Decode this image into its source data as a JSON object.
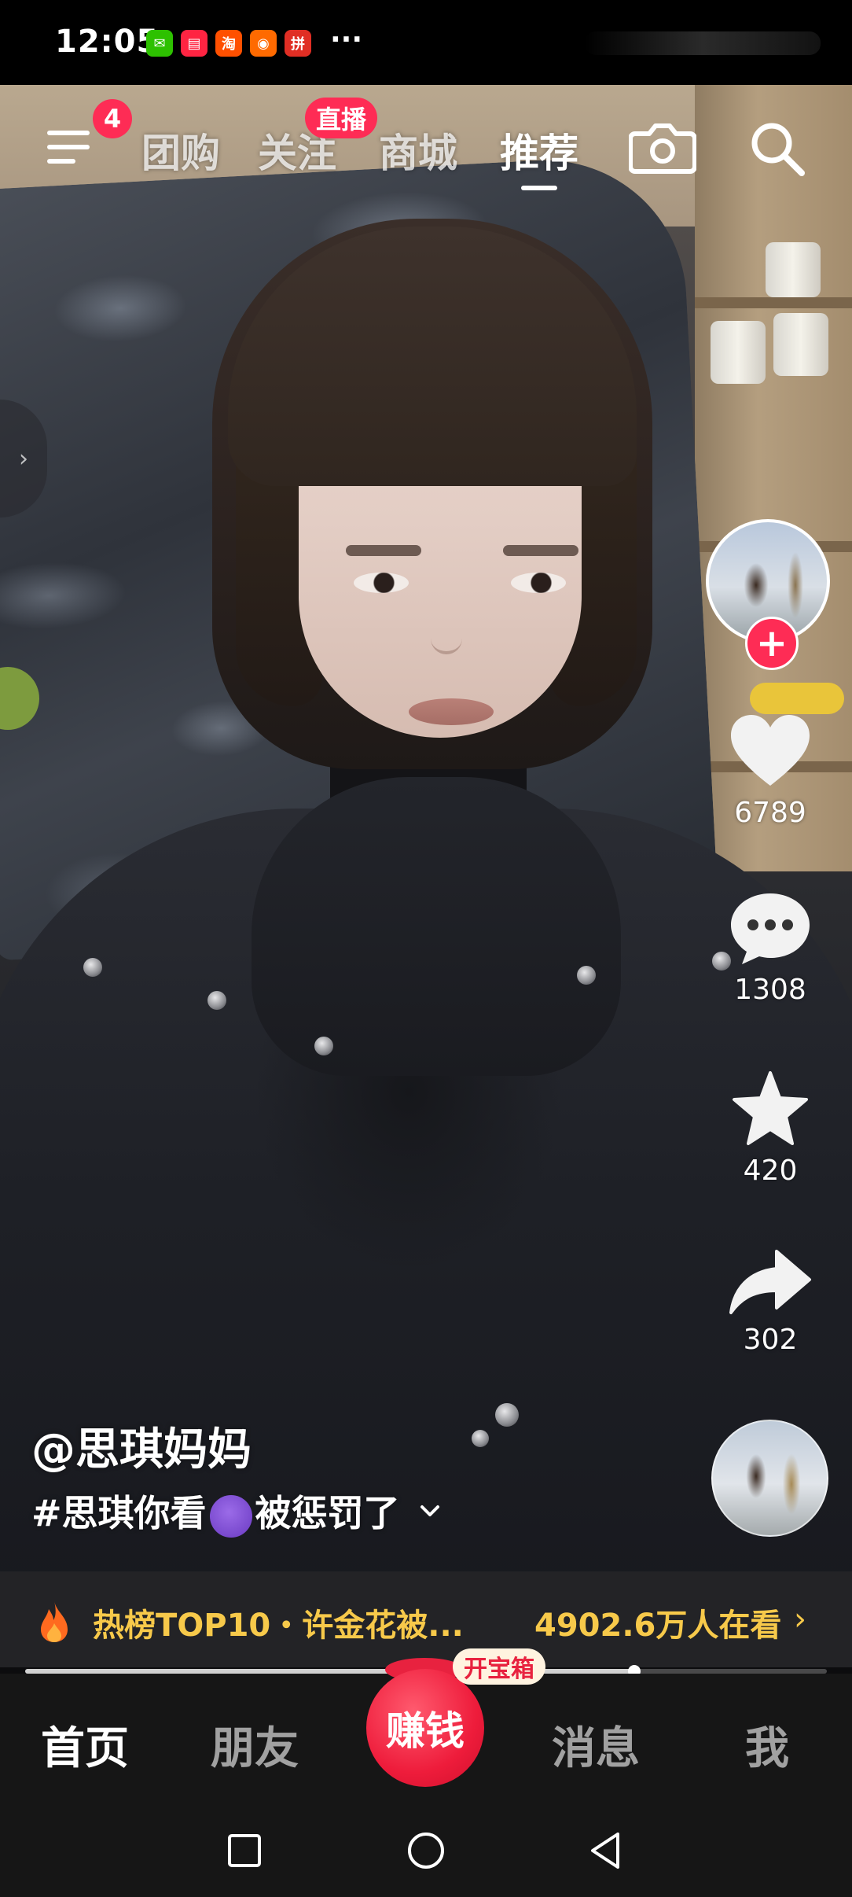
{
  "status_bar": {
    "time": "12:05",
    "notification_icons": [
      {
        "name": "wechat-icon",
        "color": "#2dc100",
        "glyph": "✉"
      },
      {
        "name": "red-note-icon",
        "color": "#ff2442",
        "glyph": "▤"
      },
      {
        "name": "taobao-icon",
        "color": "#ff5000",
        "glyph": "淘"
      },
      {
        "name": "shopping-icon",
        "color": "#ff6a00",
        "glyph": "◉"
      },
      {
        "name": "pinduoduo-icon",
        "color": "#e02e24",
        "glyph": "拼"
      }
    ],
    "more": "···"
  },
  "top_nav": {
    "menu_badge": "4",
    "tabs": [
      "团购",
      "关注",
      "商城",
      "推荐"
    ],
    "active_tab": "推荐",
    "live_badge": "直播"
  },
  "actions": {
    "likes": "6789",
    "comments": "1308",
    "favorites": "420",
    "shares": "302"
  },
  "video": {
    "author": "@思琪妈妈",
    "caption_before": "#思琪你看",
    "caption_after": "被惩罚了",
    "progress": 0.76
  },
  "hot_banner": {
    "title": "热榜TOP10・许金花被...",
    "viewers": "4902.6万人在看",
    "chevron": "›"
  },
  "tab_bar": {
    "home": "首页",
    "friends": "朋友",
    "earn": "赚钱",
    "treasure_badge": "开宝箱",
    "messages": "消息",
    "me": "我"
  },
  "colors": {
    "accent_red": "#fe2c55",
    "hot_yellow": "#f7c94a",
    "tab_bar_bg": "#161616"
  }
}
